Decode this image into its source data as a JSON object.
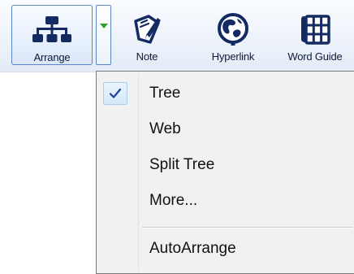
{
  "toolbar": {
    "arrange": {
      "label": "Arrange",
      "icon": "org-chart-icon"
    },
    "arrange_dropdown": {
      "icon": "dropdown-arrow-icon"
    },
    "note": {
      "label": "Note",
      "icon": "note-pencil-icon"
    },
    "hyperlink": {
      "label": "Hyperlink",
      "icon": "globe-link-icon"
    },
    "word_guide": {
      "label": "Word Guide",
      "icon": "grid-book-icon"
    }
  },
  "menu": {
    "items": [
      {
        "label": "Tree",
        "checked": true
      },
      {
        "label": "Web",
        "checked": false
      },
      {
        "label": "Split Tree",
        "checked": false
      },
      {
        "label": "More...",
        "checked": false
      },
      {
        "label": "AutoArrange",
        "checked": false
      }
    ]
  },
  "colors": {
    "toolbar_bg": "#eef3fb",
    "button_border": "#5a87c9",
    "icon_navy": "#142a63",
    "dropdown_arrow": "#2ba32b",
    "menu_bg": "#f1f1f1",
    "check_highlight": "#d3e8f9",
    "check_mark": "#1c3f9c"
  }
}
